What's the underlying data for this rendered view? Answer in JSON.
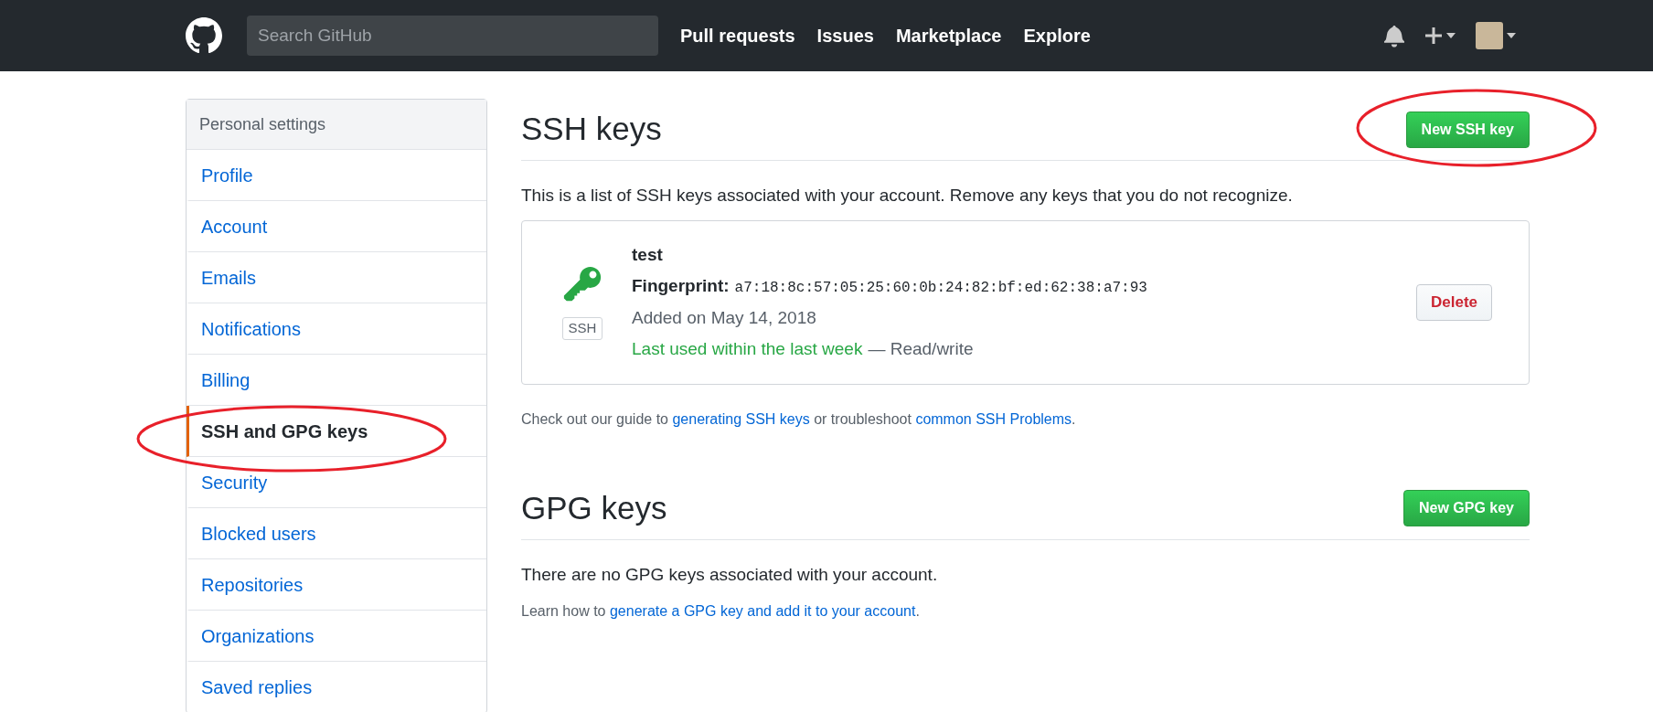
{
  "header": {
    "search": {
      "placeholder": "Search GitHub"
    },
    "nav": [
      "Pull requests",
      "Issues",
      "Marketplace",
      "Explore"
    ]
  },
  "sidebar": {
    "title": "Personal settings",
    "items": [
      {
        "label": "Profile",
        "selected": false
      },
      {
        "label": "Account",
        "selected": false
      },
      {
        "label": "Emails",
        "selected": false
      },
      {
        "label": "Notifications",
        "selected": false
      },
      {
        "label": "Billing",
        "selected": false
      },
      {
        "label": "SSH and GPG keys",
        "selected": true
      },
      {
        "label": "Security",
        "selected": false
      },
      {
        "label": "Blocked users",
        "selected": false
      },
      {
        "label": "Repositories",
        "selected": false
      },
      {
        "label": "Organizations",
        "selected": false
      },
      {
        "label": "Saved replies",
        "selected": false
      }
    ]
  },
  "ssh": {
    "title": "SSH keys",
    "button": "New SSH key",
    "description": "This is a list of SSH keys associated with your account. Remove any keys that you do not recognize.",
    "keys": [
      {
        "title": "test",
        "fingerprint_label": "Fingerprint:",
        "fingerprint": "a7:18:8c:57:05:25:60:0b:24:82:bf:ed:62:38:a7:93",
        "badge": "SSH",
        "added": "Added on May 14, 2018",
        "last_used": "Last used within the last week",
        "access": "— Read/write",
        "delete": "Delete"
      }
    ],
    "help": [
      {
        "kind": "text",
        "text": "Check out our guide to "
      },
      {
        "kind": "link",
        "text": "generating SSH keys"
      },
      {
        "kind": "text",
        "text": " or troubleshoot "
      },
      {
        "kind": "link",
        "text": "common SSH Problems"
      },
      {
        "kind": "text",
        "text": "."
      }
    ]
  },
  "gpg": {
    "title": "GPG keys",
    "button": "New GPG key",
    "empty": "There are no GPG keys associated with your account.",
    "help": [
      {
        "kind": "text",
        "text": "Learn how to "
      },
      {
        "kind": "link",
        "text": "generate a GPG key and add it to your account"
      },
      {
        "kind": "text",
        "text": "."
      }
    ]
  }
}
